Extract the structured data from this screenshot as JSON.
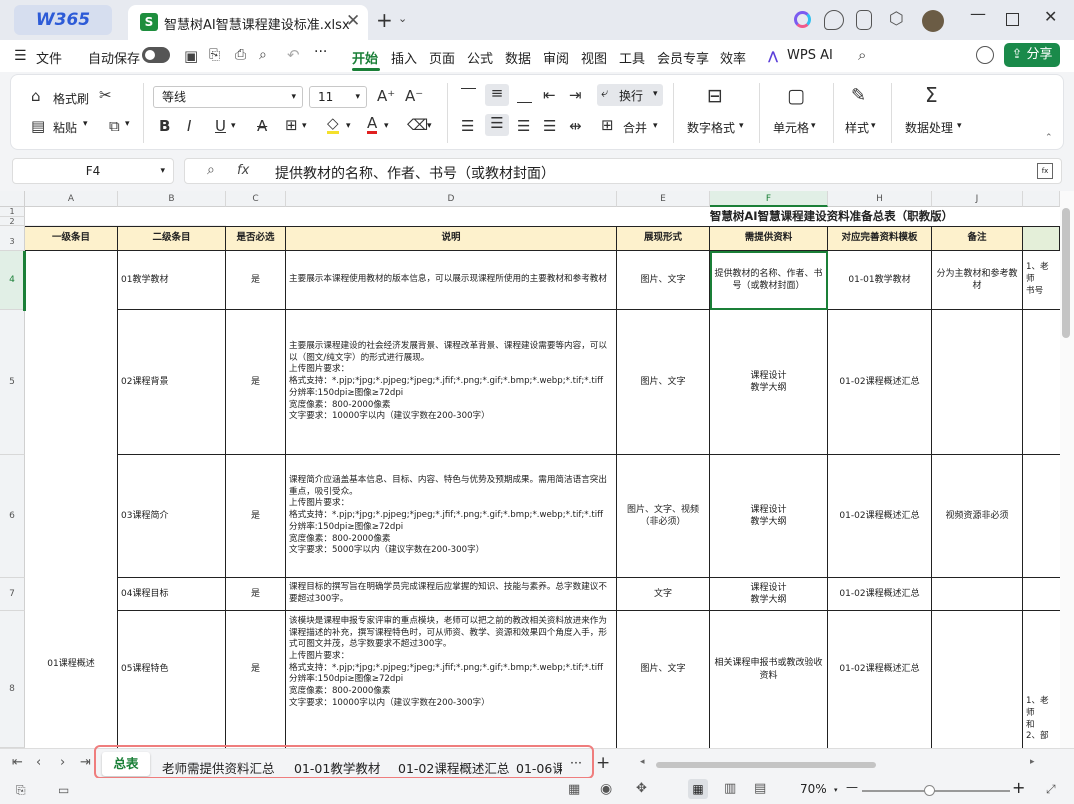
{
  "titlebar": {
    "brand": "W365",
    "doc_tab": "智慧树AI智慧课程建设标准.xlsx",
    "doc_icon": "S",
    "close": "✕",
    "new_tab": "+",
    "tab_menu": "⌄"
  },
  "menubar": {
    "file": "文件",
    "autosave": "自动保存",
    "more": "···",
    "items": [
      "开始",
      "插入",
      "页面",
      "公式",
      "数据",
      "审阅",
      "视图",
      "工具",
      "会员专享",
      "效率"
    ],
    "wps_ai": "WPS AI",
    "share": "分享"
  },
  "ribbon": {
    "format_painter": "格式刷",
    "paste": "粘贴",
    "font_name": "等线",
    "font_size": "11",
    "wrap": "换行",
    "merge": "合并",
    "number_format": "数字格式",
    "cell": "单元格",
    "style": "样式",
    "data_process": "数据处理"
  },
  "formula_bar": {
    "name_box": "F4",
    "fx": "fx",
    "content": "提供教材的名称、作者、书号（或教材封面）"
  },
  "grid": {
    "columns": [
      "A",
      "B",
      "C",
      "D",
      "E",
      "F",
      "H",
      "J"
    ],
    "rows": [
      "1",
      "2",
      "3",
      "4",
      "5",
      "6",
      "7",
      "8"
    ],
    "title": "智慧树AI智慧课程建设资料准备总表（职教版）",
    "headers": [
      "一级条目",
      "二级条目",
      "是否必选",
      "说明",
      "展现形式",
      "需提供资料",
      "对应完善资料模板",
      "备注"
    ],
    "data_rows": [
      {
        "b": "01教学教材",
        "c": "是",
        "d": "主要展示本课程使用教材的版本信息，可以展示现课程所使用的主要教材和参考教材",
        "e": "图片、文字",
        "f": "提供教材的名称、作者、书号（或教材封面）",
        "h": "01-01教学教材",
        "j": "分为主教材和参考教材",
        "k": "1、老师\n书号"
      },
      {
        "b": "02课程背景",
        "c": "是",
        "d": "主要展示课程建设的社会经济发展背景、课程改革背景、课程建设需要等内容，可以以（图文/纯文字）的形式进行展现。\n上传图片要求：\n格式支持：*.pjp;*jpg;*.pjpeg;*jpeg;*.jfif;*.png;*.gif;*.bmp;*.webp;*.tif;*.tiff\n分辨率:150dpi≥图像≥72dpi\n宽度像素：800-2000像素\n文字要求：10000字以内（建议字数在200-300字）",
        "e": "图片、文字",
        "f": "课程设计\n教学大纲",
        "h": "01-02课程概述汇总",
        "j": "",
        "k": ""
      },
      {
        "b": "03课程简介",
        "c": "是",
        "d": "课程简介应涵盖基本信息、目标、内容、特色与优势及预期成果。需用简洁语言突出重点，吸引受众。\n上传图片要求：\n格式支持：*.pjp;*jpg;*.pjpeg;*jpeg;*.jfif;*.png;*.gif;*.bmp;*.webp;*.tif;*.tiff\n分辨率:150dpi≥图像≥72dpi\n宽度像素：800-2000像素\n文字要求：5000字以内（建议字数在200-300字）",
        "e": "图片、文字、视频（非必须）",
        "f": "课程设计\n教学大纲",
        "h": "01-02课程概述汇总",
        "j": "视频资源非必须",
        "k": ""
      },
      {
        "b": "04课程目标",
        "c": "是",
        "d": "课程目标的撰写旨在明确学员完成课程后应掌握的知识、技能与素养。总字数建议不要超过300字。",
        "e": "文字",
        "f": "课程设计\n教学大纲",
        "h": "01-02课程概述汇总",
        "j": "",
        "k": ""
      },
      {
        "a": "01课程概述",
        "b": "05课程特色",
        "c": "是",
        "d": "该模块是课程申报专家评审的重点模块，老师可以把之前的教改相关资料放进来作为课程描述的补充，撰写课程特色时，可从师资、教学、资源和效果四个角度入手，形式可图文并茂，总字数要求不超过300字。\n上传图片要求：\n格式支持：*.pjp;*jpg;*.pjpeg;*jpeg;*.jfif;*.png;*.gif;*.bmp;*.webp;*.tif;*.tiff\n分辨率:150dpi≥图像≥72dpi\n宽度像素：800-2000像素\n文字要求：10000字以内（建议字数在200-300字）",
        "e": "图片、文字",
        "f": "相关课程申报书或教改验收资料",
        "h": "01-02课程概述汇总",
        "j": "",
        "k": "1、老师\n和\n2、部"
      }
    ]
  },
  "sheet_tabs": [
    "总表",
    "老师需提供资料汇总",
    "01-01教学教材",
    "01-02课程概述汇总",
    "01-06课"
  ],
  "sheet_more": "···",
  "status": {
    "zoom": "70%",
    "minus": "—",
    "plus": "+"
  }
}
